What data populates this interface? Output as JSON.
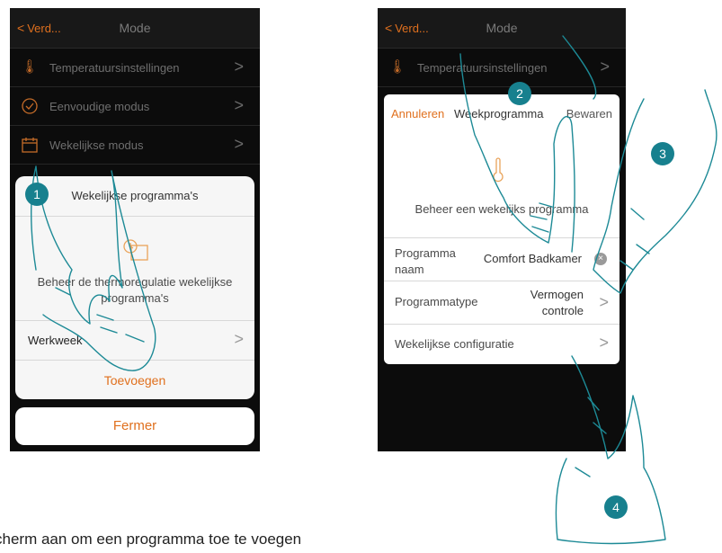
{
  "left_phone": {
    "back_label": "Verd...",
    "title": "Mode",
    "menu": [
      {
        "label": "Temperatuursinstellingen",
        "icon": "thermometer-icon"
      },
      {
        "label": "Eenvoudige modus",
        "icon": "check-circle-icon"
      },
      {
        "label": "Wekelijkse modus",
        "icon": "calendar-icon"
      }
    ],
    "sheet": {
      "title": "Wekelijkse programma's",
      "description": "Beheer de thermoregulatie wekelijkse programma's",
      "item": "Werkweek",
      "add": "Toevoegen"
    },
    "close_button": "Fermer"
  },
  "right_phone": {
    "back_label": "Verd...",
    "title": "Mode",
    "menu_first": "Temperatuursinstellingen",
    "card": {
      "cancel": "Annuleren",
      "title": "Weekprogramma",
      "save": "Bewaren",
      "description": "Beheer een wekelijks programma",
      "name_label": "Programma naam",
      "name_value": "Comfort Badkamer",
      "type_label": "Programmatype",
      "type_value": "Vermogen controle",
      "config_label": "Wekelijkse configuratie"
    }
  },
  "steps": [
    "1",
    "2",
    "3",
    "4"
  ],
  "caption": "cherm aan om een programma toe te voegen",
  "colors": {
    "accent": "#e0701e",
    "step_badge": "#17808e",
    "background_dark": "#0c0c0c"
  }
}
